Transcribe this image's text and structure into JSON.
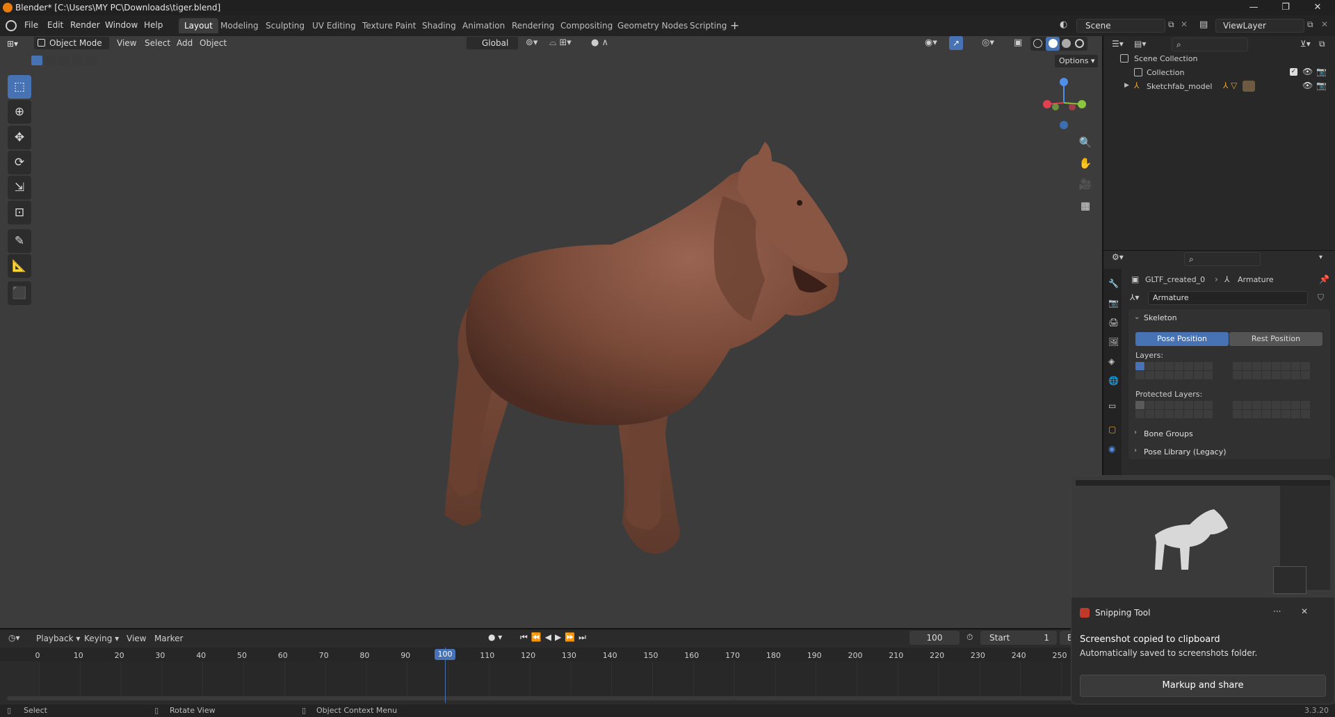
{
  "window": {
    "title": "Blender* [C:\\Users\\MY PC\\Downloads\\tiger.blend]",
    "minimize": "—",
    "maximize": "❐",
    "close": "✕"
  },
  "menu": [
    "File",
    "Edit",
    "Render",
    "Window",
    "Help"
  ],
  "workspaces": [
    "Layout",
    "Modeling",
    "Sculpting",
    "UV Editing",
    "Texture Paint",
    "Shading",
    "Animation",
    "Rendering",
    "Compositing",
    "Geometry Nodes",
    "Scripting"
  ],
  "scene": {
    "name": "Scene",
    "view_layer": "ViewLayer"
  },
  "viewport": {
    "mode": "Object Mode",
    "menus": [
      "View",
      "Select",
      "Add",
      "Object"
    ],
    "transform_orientation": "Global",
    "options": "Options"
  },
  "outliner": {
    "scene_collection": "Scene Collection",
    "collection": "Collection",
    "object": "Sketchfab_model"
  },
  "properties": {
    "breadcrumb_object": "GLTF_created_0",
    "breadcrumb_data": "Armature",
    "data_name": "Armature",
    "skeleton_panel": "Skeleton",
    "pose_position": "Pose Position",
    "rest_position": "Rest Position",
    "layers_label": "Layers:",
    "protected_layers_label": "Protected Layers:",
    "bone_groups": "Bone Groups",
    "pose_library": "Pose Library (Legacy)"
  },
  "timeline": {
    "menus": [
      "Playback",
      "Keying",
      "View",
      "Marker"
    ],
    "current_frame": "100",
    "start_label": "Start",
    "start_value": "1",
    "end_label": "End",
    "ticks": [
      "0",
      "10",
      "20",
      "30",
      "40",
      "50",
      "60",
      "70",
      "80",
      "90",
      "100",
      "110",
      "120",
      "130",
      "140",
      "150",
      "160",
      "170",
      "180",
      "190",
      "200",
      "210",
      "220",
      "230",
      "240",
      "250"
    ]
  },
  "statusbar": {
    "select": "Select",
    "rotate": "Rotate View",
    "context": "Object Context Menu",
    "version": "3.3.20"
  },
  "toast": {
    "app": "Snipping Tool",
    "more": "···",
    "close": "✕",
    "heading": "Screenshot copied to clipboard",
    "body": "Automatically saved to screenshots folder.",
    "button": "Markup and share"
  },
  "colors": {
    "accent": "#4772b3",
    "model": "#7a4a38",
    "blender_orange": "#e87d0d"
  }
}
